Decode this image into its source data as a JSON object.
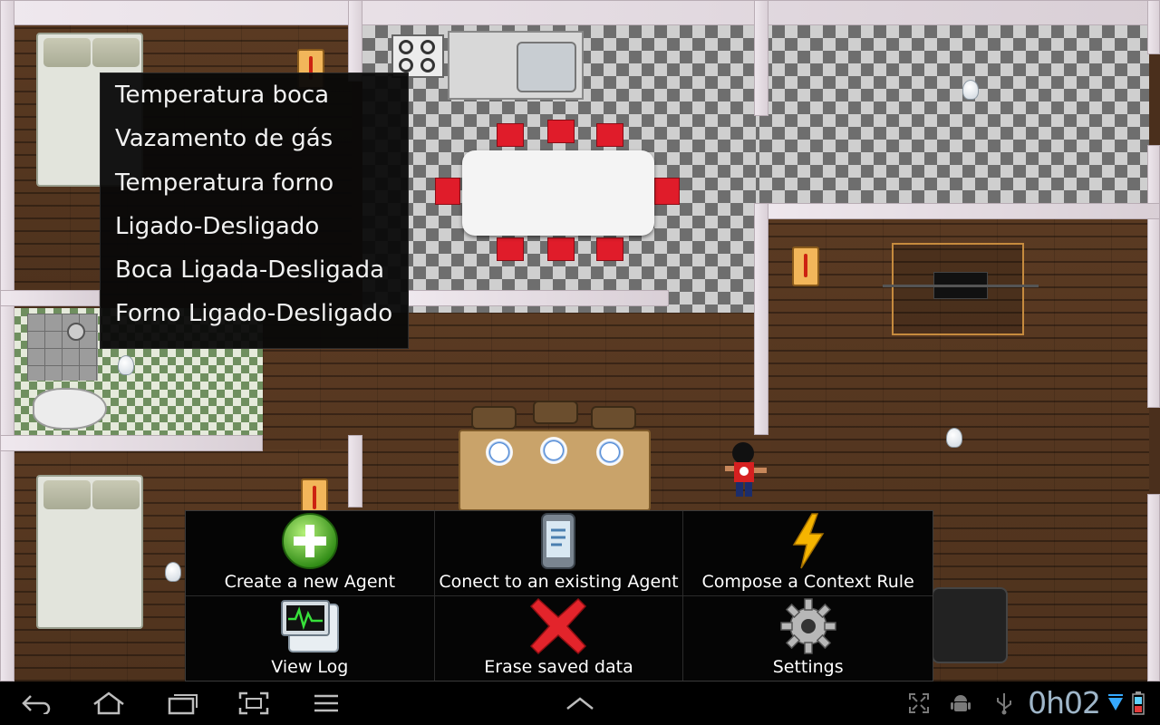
{
  "sensor_menu": {
    "items": [
      "Temperatura boca",
      "Vazamento de gás",
      "Temperatura forno",
      "Ligado-Desligado",
      "Boca Ligada-Desligada",
      "Forno Ligado-Desligado"
    ]
  },
  "options_menu": {
    "items": [
      {
        "label": "Create a new Agent",
        "icon": "plus-icon"
      },
      {
        "label": "Conect to an existing Agent",
        "icon": "phone-icon"
      },
      {
        "label": "Compose a Context Rule",
        "icon": "lightning-icon"
      },
      {
        "label": "View Log",
        "icon": "monitor-log-icon"
      },
      {
        "label": "Erase saved data",
        "icon": "red-x-icon"
      },
      {
        "label": "Settings",
        "icon": "gear-icon"
      }
    ]
  },
  "system_bar": {
    "clock": "0h02",
    "nav_icons": [
      "back-icon",
      "home-icon",
      "recent-apps-icon",
      "screenshot-icon",
      "menu-icon"
    ],
    "status_icons": [
      "expand-icon",
      "android-debug-icon",
      "usb-icon",
      "wifi-icon",
      "battery-icon"
    ]
  },
  "colors": {
    "wood_floor": "#4e321d",
    "wall": "#efe8ee",
    "menu_bg": "#050505",
    "clock": "#9fb6c9"
  }
}
